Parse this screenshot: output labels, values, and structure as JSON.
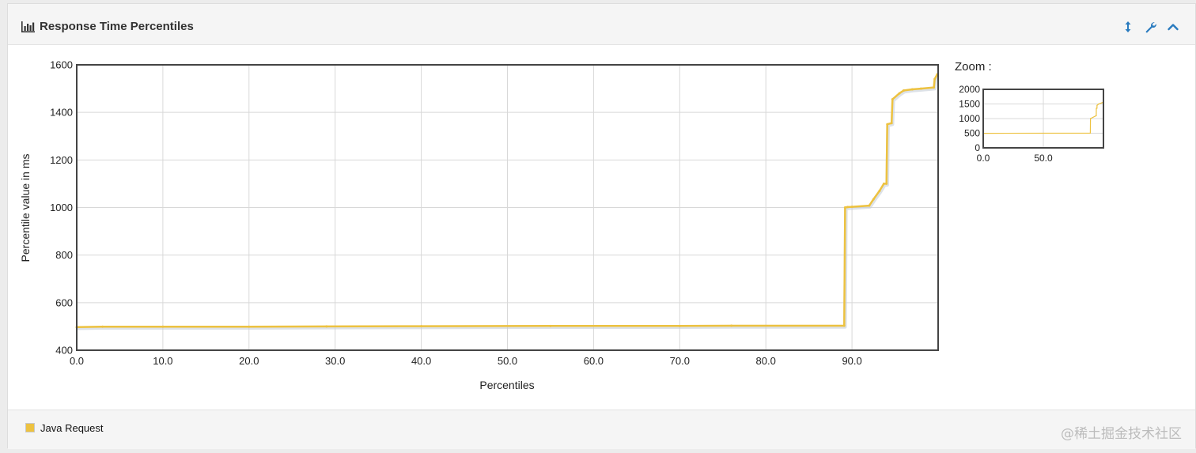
{
  "panel": {
    "title": "Response Time Percentiles",
    "icon": "bar-chart-icon",
    "tools": [
      {
        "name": "expand-vertical-icon",
        "glyph": "↕"
      },
      {
        "name": "wrench-icon",
        "glyph": "🔧"
      },
      {
        "name": "chevron-up-icon",
        "glyph": "^"
      }
    ]
  },
  "zoom": {
    "label": "Zoom :"
  },
  "legend": {
    "label": "Java Request"
  },
  "watermark": "@稀土掘金技术社区",
  "colors": {
    "series": "#edc240",
    "series_shadow": "#c7ced8",
    "grid": "#d8d8d8",
    "frame": "#444444"
  },
  "chart_data": [
    {
      "type": "line",
      "title": "",
      "xlabel": "Percentiles",
      "ylabel": "Percentile value in ms",
      "xlim": [
        0,
        100
      ],
      "ylim": [
        400,
        1600
      ],
      "xticks": [
        "0.0",
        "10.0",
        "20.0",
        "30.0",
        "40.0",
        "50.0",
        "60.0",
        "70.0",
        "80.0",
        "90.0"
      ],
      "yticks": [
        "400",
        "600",
        "800",
        "1000",
        "1200",
        "1400",
        "1600"
      ],
      "grid": true,
      "series": [
        {
          "name": "Java Request",
          "x": [
            0,
            3,
            10,
            20,
            29,
            40,
            55,
            70,
            76,
            89.1,
            89.2,
            89.5,
            90,
            92,
            92.5,
            93.2,
            93.7,
            94,
            94.1,
            94.6,
            94.7,
            95.5,
            96,
            97,
            98,
            99.5,
            99.6,
            99.9
          ],
          "y": [
            497,
            499,
            499,
            499,
            500,
            501,
            502,
            502,
            503,
            503,
            1000,
            1002,
            1003,
            1008,
            1035,
            1070,
            1100,
            1100,
            1350,
            1355,
            1455,
            1480,
            1492,
            1497,
            1500,
            1505,
            1540,
            1560
          ]
        }
      ]
    },
    {
      "type": "line",
      "title": "",
      "xlabel": "",
      "ylabel": "",
      "xlim": [
        0,
        100
      ],
      "ylim": [
        0,
        2000
      ],
      "xticks": [
        "0.0",
        "50.0"
      ],
      "yticks": [
        "0",
        "500",
        "1000",
        "1500",
        "2000"
      ],
      "grid": true,
      "series": [
        {
          "name": "Java Request",
          "x": [
            0,
            89.1,
            89.2,
            94,
            94.1,
            94.6,
            94.7,
            96,
            99.9
          ],
          "y": [
            497,
            503,
            1000,
            1100,
            1350,
            1355,
            1455,
            1497,
            1560
          ]
        }
      ]
    }
  ]
}
